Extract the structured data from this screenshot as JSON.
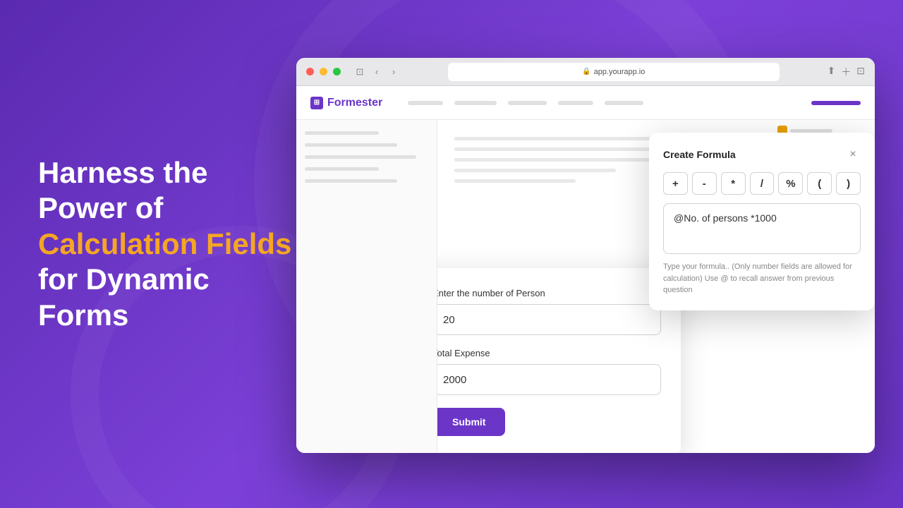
{
  "background": {
    "color": "#6B35C8"
  },
  "left_text": {
    "line1": "Harness the",
    "line2": "Power of",
    "highlight": "Calculation Fields",
    "line3": "for Dynamic",
    "line4": "Forms"
  },
  "browser": {
    "url": "app.yourapp.io",
    "dots": [
      "red",
      "yellow",
      "green"
    ]
  },
  "app_header": {
    "logo_text": "Formester",
    "nav_items": [
      "",
      "",
      "",
      "",
      ""
    ],
    "right_bar": ""
  },
  "formula_dialog": {
    "title": "Create Formula",
    "close_label": "×",
    "operators": [
      "+",
      "-",
      "*",
      "/",
      "%",
      "(",
      ")"
    ],
    "formula_value": "@No. of persons *1000",
    "hint": "Type your formula.. (Only number fields are allowed for calculation) Use @ to recall answer from previous question"
  },
  "form_card": {
    "field1_label": "Enter the number of Person",
    "field1_value": "20",
    "field2_label": "Total Expense",
    "field2_value": "2000",
    "submit_label": "Submit"
  }
}
